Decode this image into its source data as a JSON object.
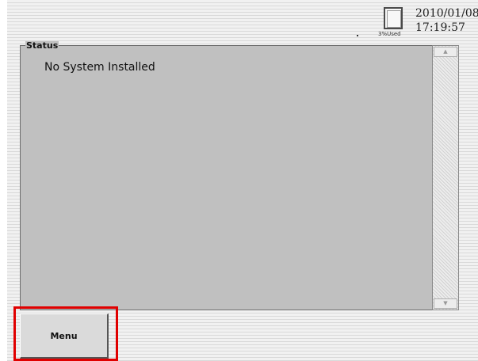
{
  "header": {
    "storage": {
      "icon": "sd-card-icon",
      "used_label": "3%Used"
    },
    "clock": {
      "date": "2010/01/08",
      "time": "17:19:57"
    }
  },
  "status": {
    "title": "Status",
    "message": "No System Installed",
    "scrollbar": {
      "up_icon": "scroll-up-arrow-icon",
      "down_icon": "scroll-down-arrow-icon",
      "up_glyph": "▲",
      "down_glyph": "▼"
    }
  },
  "footer": {
    "menu_label": "Menu",
    "highlight_color": "#e00000"
  }
}
